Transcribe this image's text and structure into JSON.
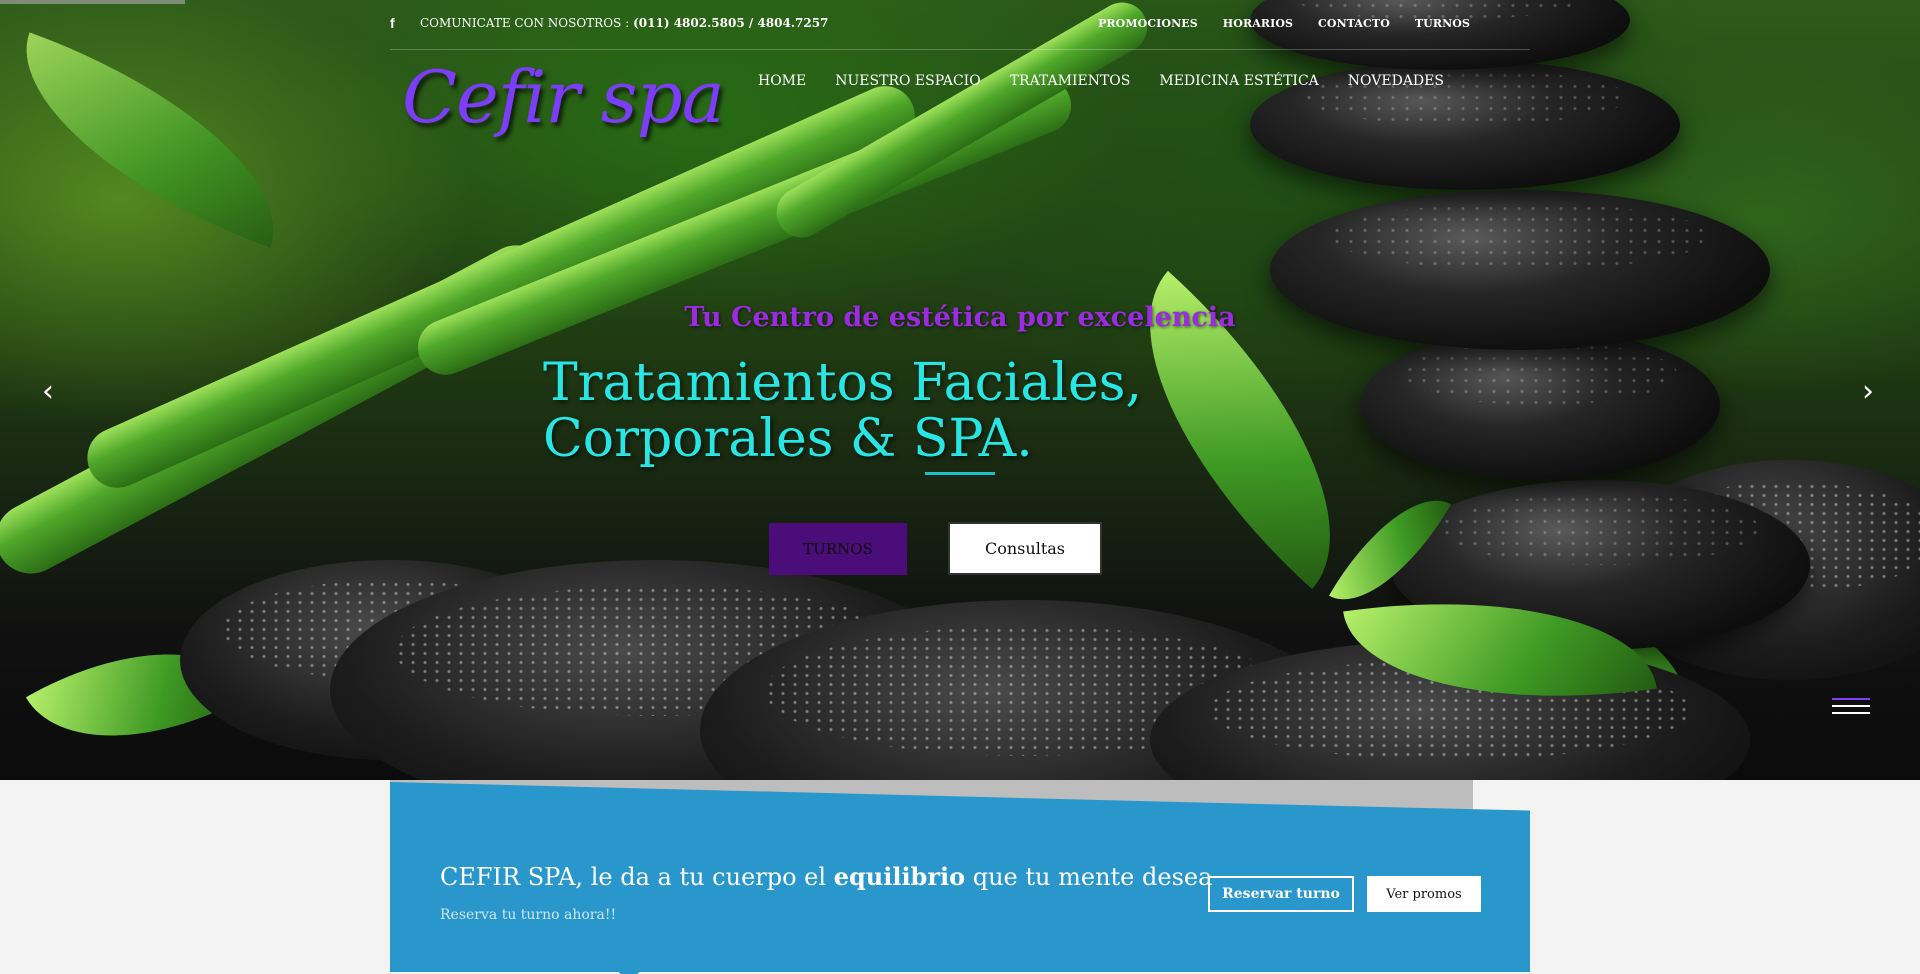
{
  "topbar": {
    "contact_label": "COMUNICATE CON NOSOTROS :",
    "phone": "(011) 4802.5805 / 4804.7257",
    "links": [
      "PROMOCIONES",
      "HORARIOS",
      "CONTACTO",
      "TURNOS"
    ]
  },
  "brand": {
    "logo": "Cefir spa",
    "logo_color": "#7b3df5"
  },
  "nav": [
    "HOME",
    "NUESTRO ESPACIO",
    "TRATAMIENTOS",
    "MEDICINA ESTÉTICA",
    "NOVEDADES"
  ],
  "hero": {
    "kicker": "Tu Centro de estética por excelencia",
    "headline": "Tratamientos Faciales, Corporales & SPA.",
    "btn_primary": "TURNOS",
    "btn_secondary": "Consultas",
    "prev_icon": "‹",
    "next_icon": "›",
    "accent": "#27e6e3"
  },
  "cta": {
    "title_pre": "CEFIR SPA, le da a tu cuerpo el ",
    "title_bold": "equilibrio",
    "title_post": " que tu mente desea",
    "subtitle": "Reserva tu turno ahora!!",
    "btn_reserve": "Reservar turno",
    "btn_promos": "Ver promos",
    "color": "#2a97cc"
  }
}
